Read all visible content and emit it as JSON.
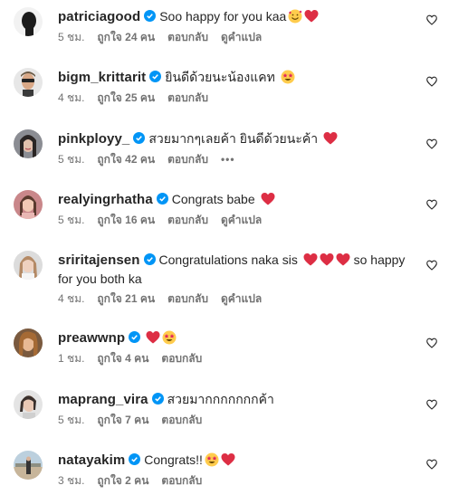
{
  "comments": [
    {
      "username": "patriciagood",
      "text": "Soo happy for you kaa",
      "emojis": [
        "smiling-face-with-hearts-emoji",
        "red-heart-emoji"
      ],
      "time": "5 ชม.",
      "likes": "ถูกใจ 24 คน",
      "reply": "ตอบกลับ",
      "translate": "ดูคำแปล",
      "more": ""
    },
    {
      "username": "bigm_krittarit",
      "text": "ยินดีด้วยนะน้องแคท",
      "emojis": [
        "star-struck-emoji"
      ],
      "time": "4 ชม.",
      "likes": "ถูกใจ 25 คน",
      "reply": "ตอบกลับ",
      "translate": "",
      "more": ""
    },
    {
      "username": "pinkployy_",
      "text": "สวยมากๆเลยค้า ยินดีด้วยนะค้า",
      "emojis": [
        "red-heart-emoji"
      ],
      "time": "5 ชม.",
      "likes": "ถูกใจ 42 คน",
      "reply": "ตอบกลับ",
      "translate": "",
      "more": "•••"
    },
    {
      "username": "realyingrhatha",
      "text": "Congrats babe",
      "emojis": [
        "red-heart-emoji"
      ],
      "time": "5 ชม.",
      "likes": "ถูกใจ 16 คน",
      "reply": "ตอบกลับ",
      "translate": "ดูคำแปล",
      "more": ""
    },
    {
      "username": "sriritajensen",
      "text": "Congratulations naka sis",
      "text_after": "so happy",
      "text_line2": "for you both ka",
      "emojis": [
        "red-heart-emoji",
        "red-heart-emoji",
        "red-heart-emoji"
      ],
      "time": "4 ชม.",
      "likes": "ถูกใจ 21 คน",
      "reply": "ตอบกลับ",
      "translate": "ดูคำแปล",
      "more": ""
    },
    {
      "username": "preawwnp",
      "text": "",
      "emojis": [
        "red-heart-emoji",
        "star-struck-emoji"
      ],
      "time": "1 ชม.",
      "likes": "ถูกใจ 4 คน",
      "reply": "ตอบกลับ",
      "translate": "",
      "more": ""
    },
    {
      "username": "maprang_vira",
      "text": "สวยมากกกกกกกค้า",
      "emojis": [],
      "time": "5 ชม.",
      "likes": "ถูกใจ 7 คน",
      "reply": "ตอบกลับ",
      "translate": "",
      "more": ""
    },
    {
      "username": "natayakim",
      "text": "Congrats!!",
      "emojis": [
        "star-struck-emoji",
        "red-heart-emoji"
      ],
      "time": "3 ชม.",
      "likes": "ถูกใจ 2 คน",
      "reply": "ตอบกลับ",
      "translate": "",
      "more": ""
    }
  ],
  "colors": {
    "text": "#262626",
    "meta": "#737373",
    "verified": "#0095f6",
    "heart": "#e0245e"
  }
}
